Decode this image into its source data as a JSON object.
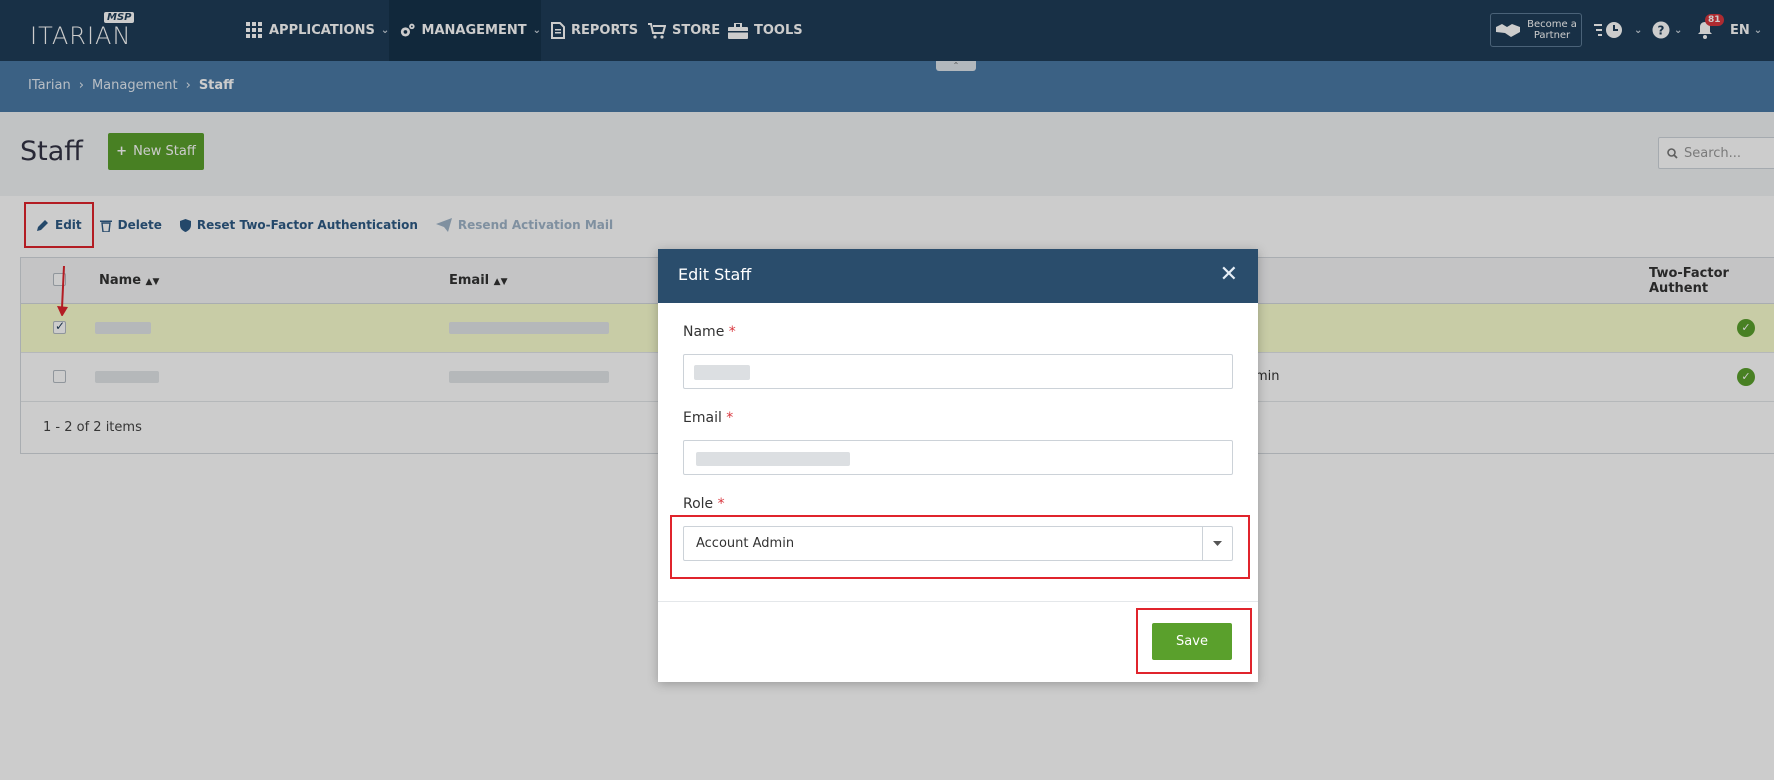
{
  "nav": {
    "logo_text": "ITARIAN",
    "logo_badge": "MSP",
    "items": [
      {
        "label": "APPLICATIONS",
        "icon": "grid-icon"
      },
      {
        "label": "MANAGEMENT",
        "icon": "gears-icon"
      },
      {
        "label": "REPORTS",
        "icon": "document-icon"
      },
      {
        "label": "STORE",
        "icon": "cart-icon"
      },
      {
        "label": "TOOLS",
        "icon": "toolbox-icon"
      }
    ],
    "partner_label_1": "Become a",
    "partner_label_2": "Partner",
    "notification_count": "81",
    "language": "EN"
  },
  "breadcrumb": [
    "ITarian",
    "Management",
    "Staff"
  ],
  "page": {
    "title": "Staff",
    "new_button": "New Staff",
    "search_placeholder": "Search..."
  },
  "toolbar": {
    "edit": "Edit",
    "delete": "Delete",
    "reset_2fa": "Reset Two-Factor Authentication",
    "resend": "Resend Activation Mail"
  },
  "grid": {
    "columns": [
      "Name",
      "Email",
      "Two-Factor Authent"
    ],
    "row2_role_fragment": "min",
    "footer": "1 - 2 of 2 items"
  },
  "modal": {
    "title": "Edit Staff",
    "name_label": "Name",
    "email_label": "Email",
    "role_label": "Role",
    "required_mark": "*",
    "role_value": "Account Admin",
    "save": "Save"
  },
  "colors": {
    "nav_bg": "#1f3d58",
    "breadcrumb_bg": "#4a7aa6",
    "accent_green": "#5aa02c",
    "highlight_red": "#e0242c",
    "modal_header": "#2a4d6c"
  }
}
